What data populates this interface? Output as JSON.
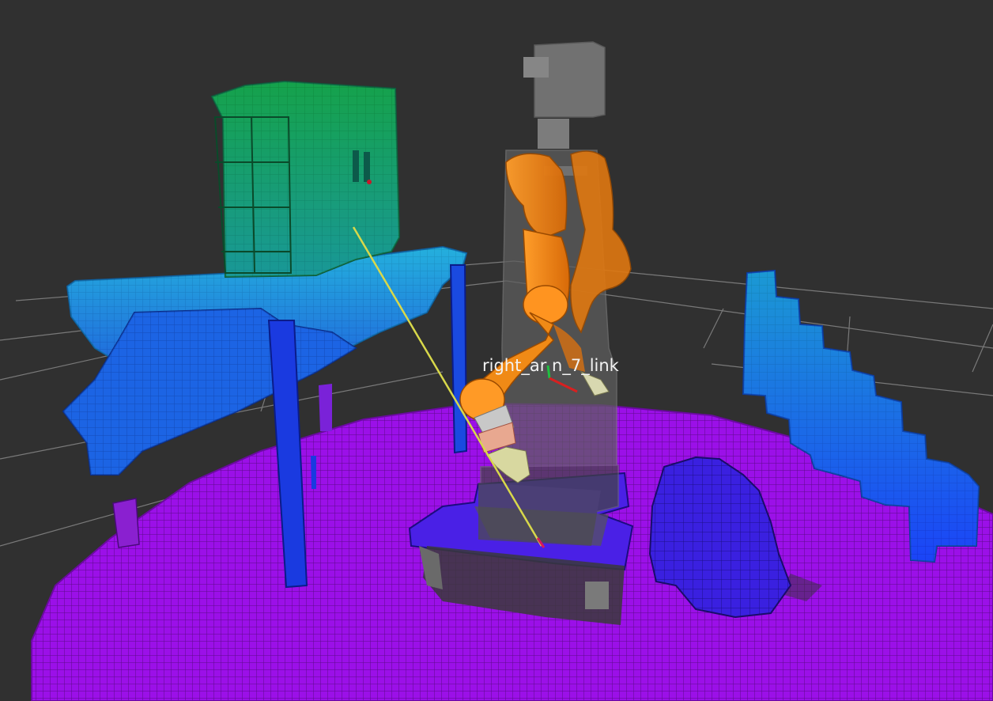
{
  "scene": {
    "background_color": "#303030",
    "grid_color": "#a0a0a0",
    "frame_label": "right_ar n_7_link"
  },
  "objects": [
    {
      "name": "ground-plane-voxels",
      "color": "#a000ff"
    },
    {
      "name": "table-voxels",
      "color": "#1aa5e0"
    },
    {
      "name": "cabinet-voxels",
      "color": "#19a33a"
    },
    {
      "name": "right-wall-voxels",
      "color": "#1a5fff"
    },
    {
      "name": "base-platform-voxels",
      "color": "#4c1fff"
    },
    {
      "name": "robot-arm",
      "color": "#ff8a14"
    },
    {
      "name": "robot-body",
      "color": "#7a7a7a"
    },
    {
      "name": "tool-ray",
      "color": "#d8d84a"
    }
  ]
}
